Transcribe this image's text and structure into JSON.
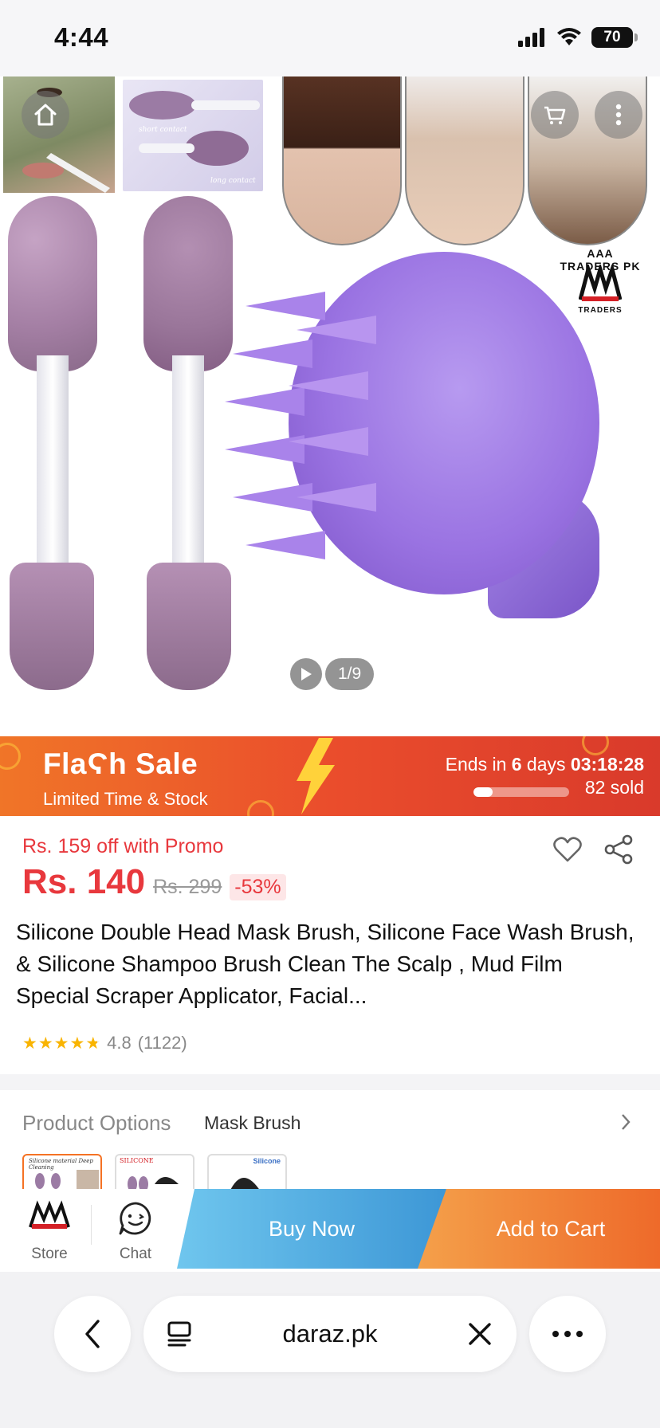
{
  "status_bar": {
    "time": "4:44",
    "battery": "70",
    "signal_icon": "cellular-signal-icon",
    "wifi_icon": "wifi-icon"
  },
  "gallery": {
    "counter": "1/9",
    "brand_logo_text": "AAA TRADERS PK",
    "brand_logo_sub": "TRADERS",
    "thumb_label_1": "short contact",
    "thumb_label_2": "long contact",
    "icons": [
      "home-icon",
      "cart-icon",
      "more-icon",
      "play-icon"
    ]
  },
  "flash_sale": {
    "title": "FlaϚh Sale",
    "subtitle": "Limited Time & Stock",
    "ends_prefix": "Ends in ",
    "ends_days": "6",
    "ends_days_unit": " days ",
    "ends_time": "03:18:28",
    "sold": "82 sold",
    "sold_progress": 0.2
  },
  "product": {
    "promo": "Rs. 159 off with Promo",
    "price": "Rs. 140",
    "original_price": "Rs. 299",
    "discount": "-53%",
    "title": "Silicone Double Head Mask Brush, Silicone Face Wash Brush, & Silicone Shampoo Brush Clean The Scalp , Mud Film Special Scraper Applicator, Facial...",
    "rating": "4.8",
    "rating_count": "(1122)",
    "stars": 4.8
  },
  "options": {
    "label": "Product Options",
    "value": "Mask Brush",
    "thumbs": [
      "Silicone material Deep Cleaning",
      "SILICONE",
      "Silicone"
    ]
  },
  "actions": {
    "store": "Store",
    "chat": "Chat",
    "buy_now": "Buy Now",
    "add_to_cart": "Add to Cart"
  },
  "browser": {
    "url": "daraz.pk"
  },
  "colors": {
    "price_red": "#e8383d",
    "flash_orange": "#f07528",
    "buy_now_blue": "#3d97d6",
    "add_cart_orange": "#ee6a2a",
    "scalp_brush_purple": "#9a73e2"
  }
}
